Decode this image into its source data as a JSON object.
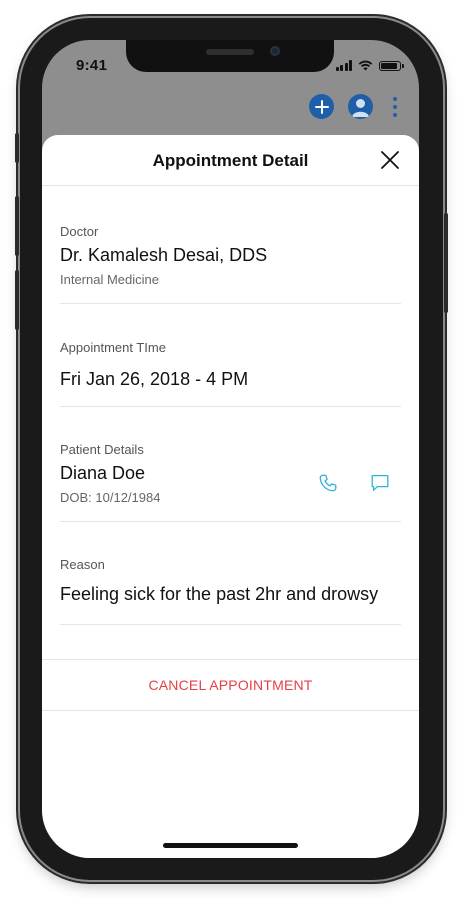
{
  "status_bar": {
    "time": "9:41"
  },
  "top_actions": {
    "add_icon": "plus-icon",
    "avatar_icon": "user-avatar-icon",
    "menu_icon": "kebab-menu-icon"
  },
  "sheet": {
    "title": "Appointment Detail",
    "close_icon": "close-icon"
  },
  "doctor": {
    "label": "Doctor",
    "name": "Dr. Kamalesh Desai, DDS",
    "specialty": "Internal Medicine"
  },
  "appointment_time": {
    "label": "Appointment TIme",
    "value": "Fri Jan 26, 2018 - 4 PM"
  },
  "patient": {
    "label": "Patient Details",
    "name": "Diana Doe",
    "dob": "DOB: 10/12/1984",
    "phone_icon": "phone-icon",
    "message_icon": "message-icon"
  },
  "reason": {
    "label": "Reason",
    "value": "Feeling sick for the past 2hr and drowsy"
  },
  "actions": {
    "cancel_label": "CANCEL APPOINTMENT"
  },
  "colors": {
    "accent": "#1f5ea8",
    "danger": "#e63f45",
    "icon_teal": "#2fb3d8"
  }
}
